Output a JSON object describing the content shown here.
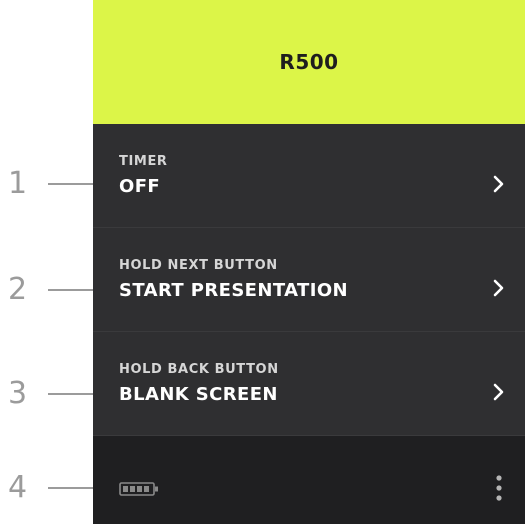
{
  "header": {
    "title": "R500"
  },
  "callouts": [
    "1",
    "2",
    "3",
    "4"
  ],
  "settings": [
    {
      "caption": "TIMER",
      "value": "OFF"
    },
    {
      "caption": "HOLD NEXT BUTTON",
      "value": "START PRESENTATION"
    },
    {
      "caption": "HOLD BACK BUTTON",
      "value": "BLANK SCREEN"
    }
  ],
  "footer": {
    "battery_icon": "battery-icon",
    "menu_icon": "more-vertical-icon"
  },
  "colors": {
    "accent": "#dcf548",
    "panel": "#2f2f31",
    "footer": "#1f1f21",
    "text": "#ffffff",
    "callout": "#9b9b9b"
  }
}
